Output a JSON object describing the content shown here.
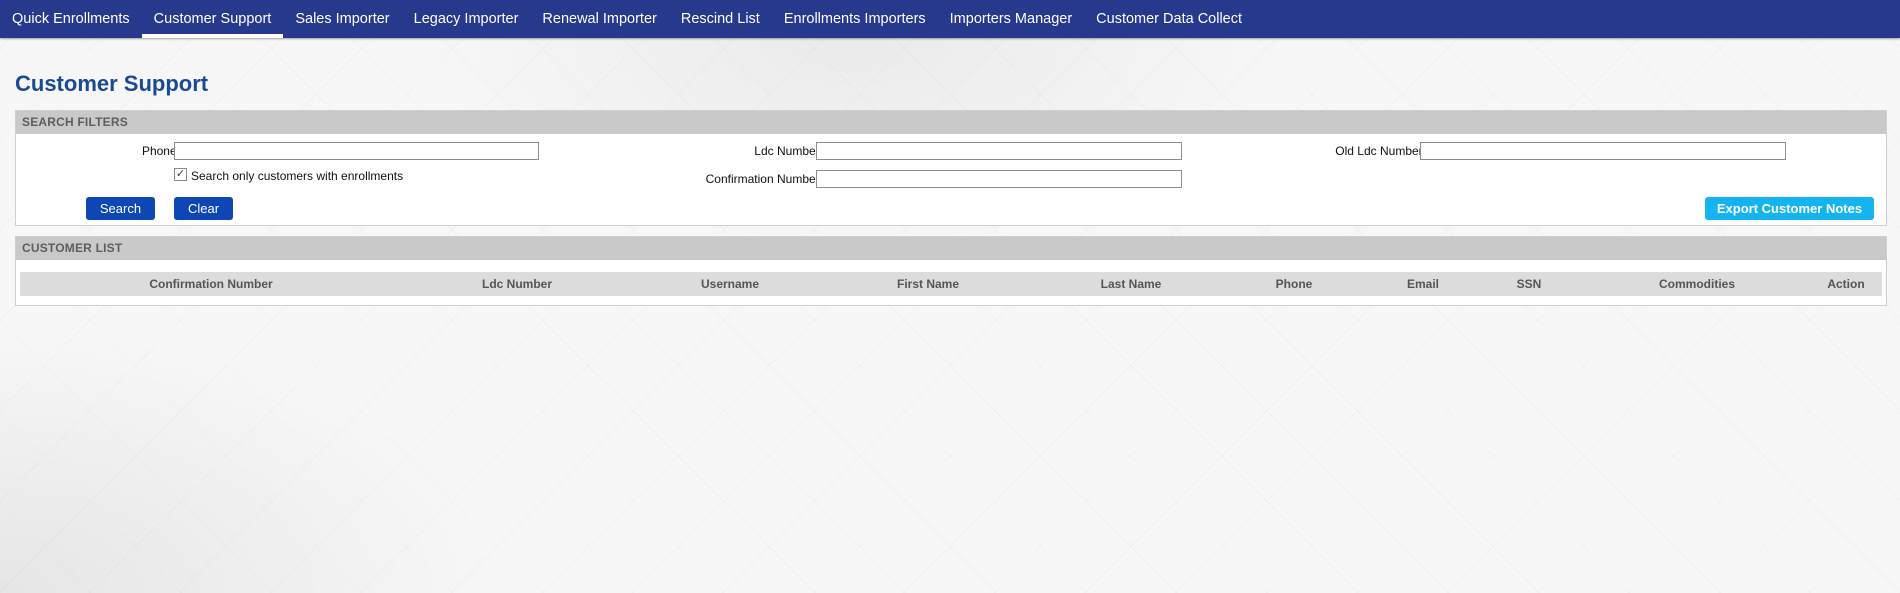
{
  "nav": {
    "items": [
      {
        "label": "Quick Enrollments"
      },
      {
        "label": "Customer Support"
      },
      {
        "label": "Sales Importer"
      },
      {
        "label": "Legacy Importer"
      },
      {
        "label": "Renewal Importer"
      },
      {
        "label": "Rescind List"
      },
      {
        "label": "Enrollments Importers"
      },
      {
        "label": "Importers Manager"
      },
      {
        "label": "Customer Data Collect"
      }
    ],
    "active_index": 1
  },
  "page": {
    "title": "Customer Support"
  },
  "filters": {
    "header": "SEARCH FILTERS",
    "phone_label": "Phone:",
    "phone_value": "",
    "ldc_label": "Ldc Number:",
    "ldc_value": "",
    "old_ldc_label": "Old Ldc Number:",
    "old_ldc_value": "",
    "confirmation_label": "Confirmation Number:",
    "confirmation_value": "",
    "enrollments_only_label": "Search only customers with enrollments",
    "enrollments_only_checked": true,
    "search_label": "Search",
    "clear_label": "Clear",
    "export_label": "Export Customer Notes"
  },
  "customer_list": {
    "header": "CUSTOMER LIST",
    "columns": [
      "Confirmation Number",
      "Ldc Number",
      "Username",
      "First Name",
      "Last Name",
      "Phone",
      "Email",
      "SSN",
      "Commodities",
      "Action"
    ]
  },
  "colors": {
    "nav_bg": "#26398c",
    "title": "#1a4a93",
    "primary_button": "#0d47b5",
    "export_button": "#14b4f0",
    "panel_header": "#c9c9c9"
  },
  "icons": {
    "checkbox_checked": "checkmark-icon"
  }
}
